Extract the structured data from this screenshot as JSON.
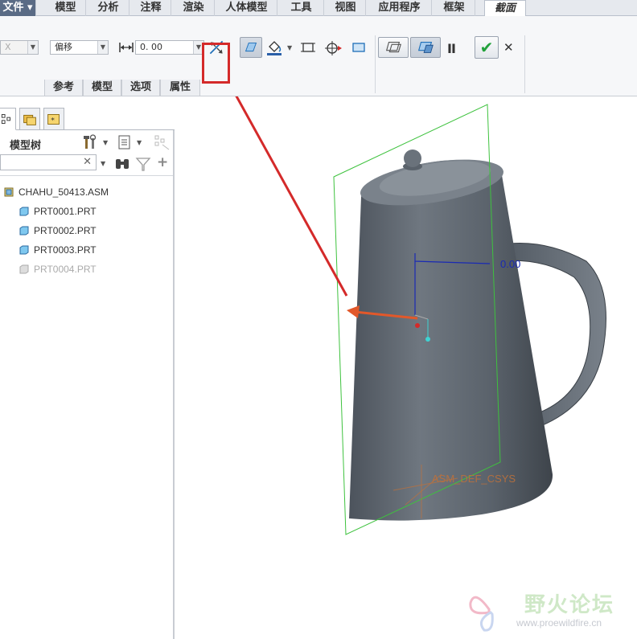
{
  "menubar": {
    "tabs": [
      "文件",
      "模型",
      "分析",
      "注释",
      "渲染",
      "人体模型",
      "工具",
      "视图",
      "应用程序",
      "框架",
      "截面"
    ],
    "file_arrow": "▾"
  },
  "ribbon": {
    "axis_combo": "X",
    "type_combo": "偏移",
    "offset_value": "0. 00",
    "subtabs": [
      "参考",
      "模型",
      "选项",
      "属性"
    ],
    "confirm_symbol": "✔",
    "cancel_symbol": "✕",
    "pause_symbol": "II"
  },
  "model_tree": {
    "title": "模型树",
    "search_clear": "✕",
    "filter_plus": "+",
    "items": [
      {
        "label": "CHAHU_50413.ASM",
        "dim": false
      },
      {
        "label": "PRT0001.PRT",
        "dim": false
      },
      {
        "label": "PRT0002.PRT",
        "dim": false
      },
      {
        "label": "PRT0003.PRT",
        "dim": false
      },
      {
        "label": "PRT0004.PRT",
        "dim": true
      }
    ]
  },
  "viewport": {
    "dimension_label": "0.00",
    "csys_label": "ASM_DEF_CSYS"
  },
  "watermark": {
    "title": "野火论坛",
    "url": "www.proewildfire.cn"
  },
  "colors": {
    "highlight": "#d42a2a",
    "datum_plane": "#3ec23e",
    "dimension": "#1a2ab3",
    "drag_arrow": "#e2582a",
    "model_body": "#5f6772"
  }
}
